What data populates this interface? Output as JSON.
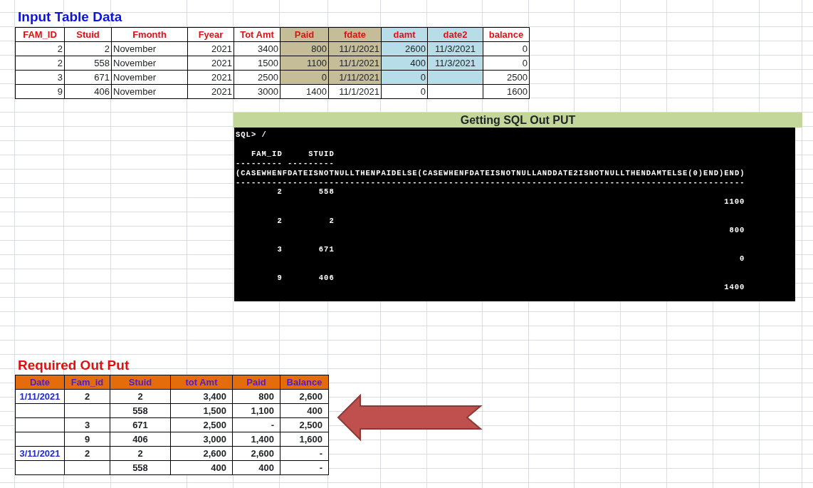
{
  "input_section": {
    "title": "Input Table Data",
    "columns": [
      {
        "label": "FAM_ID"
      },
      {
        "label": "Stuid"
      },
      {
        "label": "Fmonth"
      },
      {
        "label": "Fyear"
      },
      {
        "label": "Tot Amt"
      },
      {
        "label": "Paid",
        "color": "#c4bd97"
      },
      {
        "label": "fdate",
        "color": "#c4bd97"
      },
      {
        "label": "damt",
        "color": "#b7dee8"
      },
      {
        "label": "date2",
        "color": "#b7dee8"
      },
      {
        "label": "balance"
      }
    ],
    "rows": [
      {
        "highlighted": true,
        "cells": [
          "2",
          "2",
          "November",
          "2021",
          "3400",
          "800",
          "11/1/2021",
          "2600",
          "11/3/2021",
          "0"
        ]
      },
      {
        "highlighted": true,
        "cells": [
          "2",
          "558",
          "November",
          "2021",
          "1500",
          "1100",
          "11/1/2021",
          "400",
          "11/3/2021",
          "0"
        ]
      },
      {
        "highlighted": true,
        "cells": [
          "3",
          "671",
          "November",
          "2021",
          "2500",
          "0",
          "1/11/2021",
          "0",
          "",
          "2500"
        ]
      },
      {
        "highlighted": false,
        "cells": [
          "9",
          "406",
          "November",
          "2021",
          "3000",
          "1400",
          "11/1/2021",
          "0",
          "",
          "1600"
        ]
      }
    ]
  },
  "sql_section": {
    "title": "Getting SQL Out PUT",
    "terminal": {
      "prompt": "SQL> /",
      "headers": [
        "FAM_ID",
        "STUID"
      ],
      "header_rule": "--------- ---------",
      "expression": "(CASEWHENFDATEISNOTNULLTHENPAIDELSE(CASEWHENFDATEISNOTNULLANDDATE2ISNOTNULLTHENDAMTELSE(0)END)END)",
      "expression_rule": "--------------------------------------------------------------------------------------------------",
      "rows": [
        {
          "fam_id": "2",
          "stuid": "558",
          "value": "1100"
        },
        {
          "fam_id": "2",
          "stuid": "2",
          "value": "800"
        },
        {
          "fam_id": "3",
          "stuid": "671",
          "value": "0"
        },
        {
          "fam_id": "9",
          "stuid": "406",
          "value": "1400"
        }
      ]
    }
  },
  "output_section": {
    "title": "Required Out Put",
    "columns": [
      "Date",
      "Fam_id",
      "Stuid",
      "tot Amt",
      "Paid",
      "Balance"
    ],
    "rows": [
      [
        "1/11/2021",
        "2",
        "2",
        "3,400",
        "800",
        "2,600"
      ],
      [
        "",
        "",
        "558",
        "1,500",
        "1,100",
        "400"
      ],
      [
        "",
        "3",
        "671",
        "2,500",
        "-",
        "2,500"
      ],
      [
        "",
        "9",
        "406",
        "3,000",
        "1,400",
        "1,600"
      ],
      [
        "3/11/2021",
        "2",
        "2",
        "2,600",
        "2,600",
        "-"
      ],
      [
        "",
        "",
        "558",
        "400",
        "400",
        "-"
      ]
    ]
  }
}
